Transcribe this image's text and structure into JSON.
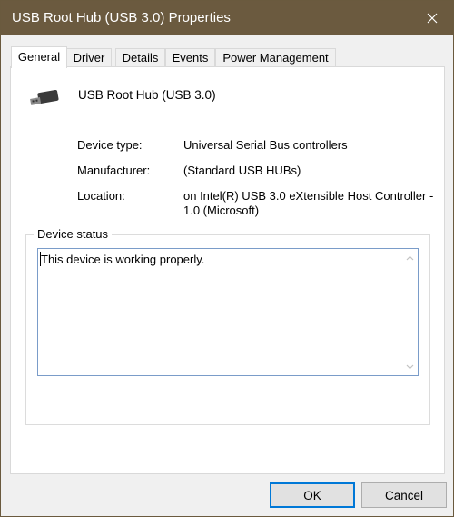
{
  "window": {
    "title": "USB Root Hub (USB 3.0) Properties"
  },
  "tabs": [
    {
      "label": "General",
      "active": true
    },
    {
      "label": "Driver",
      "active": false
    },
    {
      "label": "Details",
      "active": false
    },
    {
      "label": "Events",
      "active": false
    },
    {
      "label": "Power Management",
      "active": false
    }
  ],
  "device": {
    "name": "USB Root Hub (USB 3.0)",
    "icon": "usb-device-icon",
    "fields": [
      {
        "label": "Device type:",
        "value": "Universal Serial Bus controllers"
      },
      {
        "label": "Manufacturer:",
        "value": "(Standard USB HUBs)"
      },
      {
        "label": "Location:",
        "value": "on Intel(R) USB 3.0 eXtensible Host Controller - 1.0 (Microsoft)"
      }
    ]
  },
  "status": {
    "legend": "Device status",
    "text": "This device is working properly."
  },
  "buttons": {
    "ok": "OK",
    "cancel": "Cancel"
  },
  "colors": {
    "titlebar": "#6b5a3f",
    "focus_border": "#0078d7"
  }
}
